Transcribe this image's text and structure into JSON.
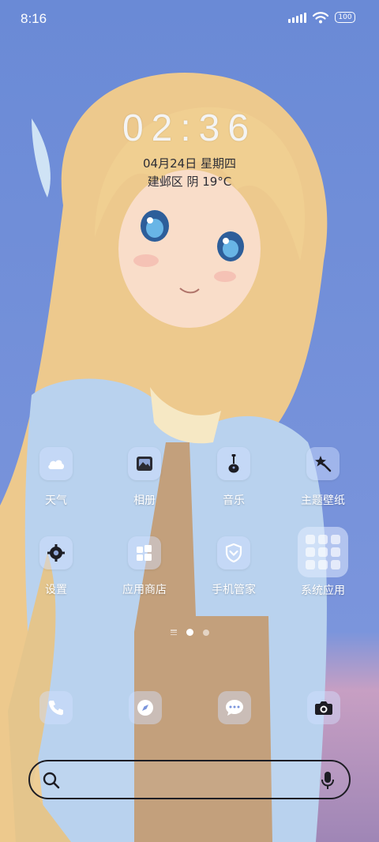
{
  "status_bar": {
    "time": "8:16",
    "battery": "100"
  },
  "clock_widget": {
    "time": "02:36",
    "date": "04月24日 星期四",
    "weather": "建邺区 阴 19°C"
  },
  "apps": [
    {
      "label": "天气",
      "icon": "cloud-icon"
    },
    {
      "label": "相册",
      "icon": "gallery-icon"
    },
    {
      "label": "音乐",
      "icon": "guitar-icon"
    },
    {
      "label": "主题壁纸",
      "icon": "magic-wand-icon"
    },
    {
      "label": "设置",
      "icon": "gear-icon"
    },
    {
      "label": "应用商店",
      "icon": "app-store-icon"
    },
    {
      "label": "手机管家",
      "icon": "shield-icon"
    },
    {
      "label": "系统应用",
      "icon": "folder-icon"
    }
  ],
  "dock": [
    {
      "icon": "phone-icon"
    },
    {
      "icon": "compass-icon"
    },
    {
      "icon": "message-icon"
    },
    {
      "icon": "camera-icon"
    }
  ],
  "page_indicator": {
    "pages": 2,
    "active": 1
  },
  "colors": {
    "accent": "#6f8fd6",
    "text_dark": "#2d2d35"
  }
}
